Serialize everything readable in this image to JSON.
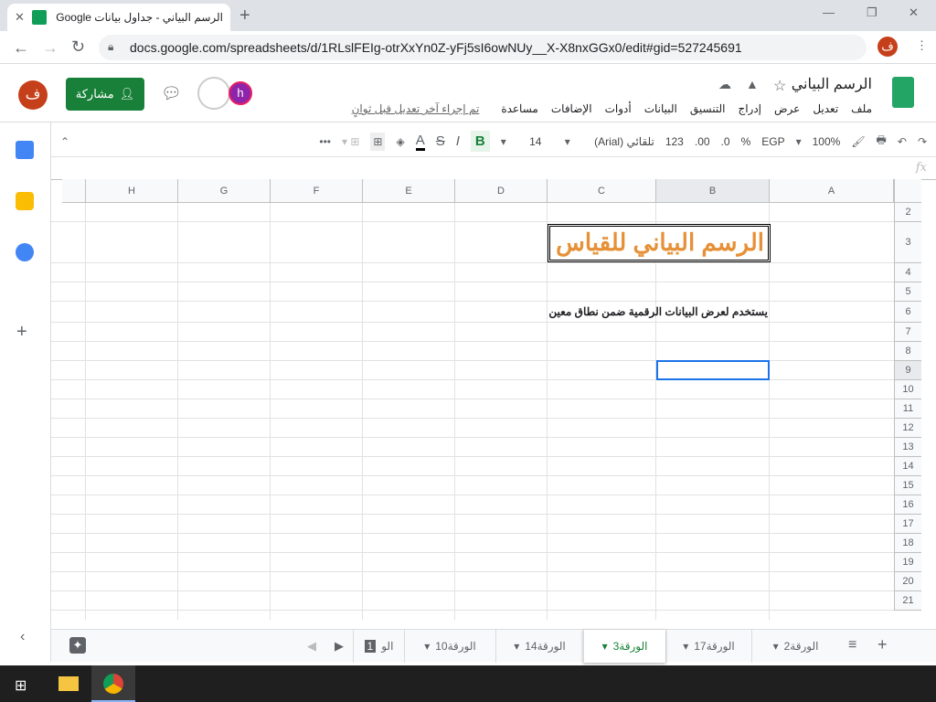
{
  "browser": {
    "tab_title": "الرسم البياني - جداول بيانات Google",
    "url": "docs.google.com/spreadsheets/d/1RLslFEIg-otrXxYn0Z-yFj5sI6owNUy__X-X8nxGGx0/edit#gid=527245691",
    "profile": "ف"
  },
  "doc": {
    "title": "الرسم البياني",
    "menu": [
      "ملف",
      "تعديل",
      "عرض",
      "إدراج",
      "التنسيق",
      "البيانات",
      "أدوات",
      "الإضافات",
      "مساعدة"
    ],
    "last_edit": "تم إجراء آخر تعديل قبل ثوانٍ",
    "share": "مشاركة",
    "avatar": "ف",
    "collab": "h"
  },
  "toolbar": {
    "zoom": "100%",
    "currency": "EGP",
    "percent": "%",
    "dec_dec": ".0",
    "inc_dec": ".00",
    "format": "123",
    "font": "تلقائي (Arial)",
    "size": "14",
    "bold": "B",
    "italic": "I",
    "strike": "S",
    "color": "A"
  },
  "fx": "fx",
  "columns": [
    "A",
    "B",
    "C",
    "D",
    "E",
    "F",
    "G",
    "H"
  ],
  "rows": [
    "2",
    "3",
    "4",
    "5",
    "6",
    "7",
    "8",
    "9",
    "10",
    "11",
    "12",
    "13",
    "14",
    "15",
    "16",
    "17",
    "18",
    "19",
    "20",
    "21"
  ],
  "cells": {
    "title": "الرسم البياني للقياس",
    "subtitle": "يستخدم لعرض البيانات الرقمية ضمن نطاق معين"
  },
  "sheets": [
    "الورقة2",
    "الورقة17",
    "الورقة3",
    "الورقة14",
    "الورقة10",
    "الو"
  ],
  "active_sheet": "الورقة3",
  "badge": "1",
  "colors": {
    "accent": "#188038",
    "title": "#e69138"
  }
}
